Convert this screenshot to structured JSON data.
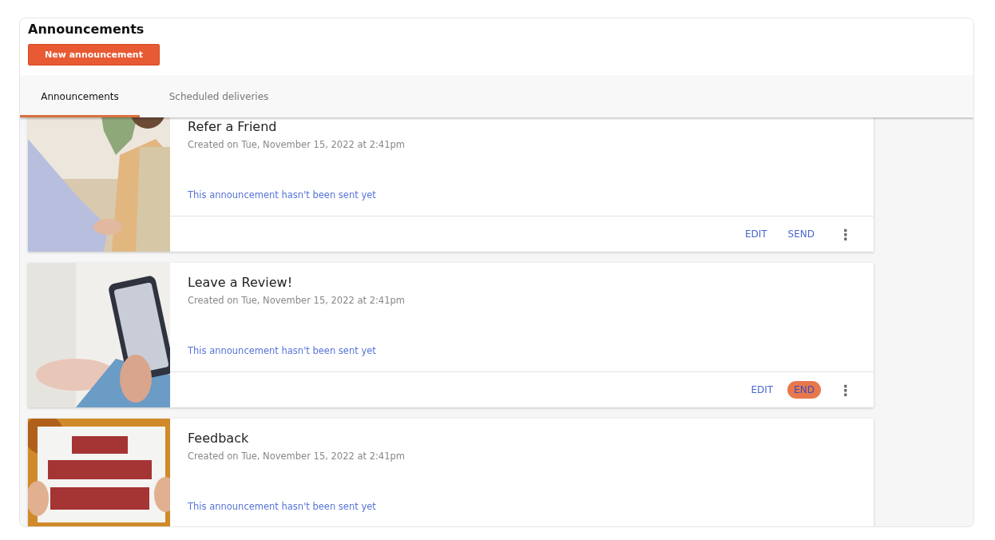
{
  "page": {
    "title": "Announcements",
    "new_button": "New announcement"
  },
  "tabs": [
    {
      "label": "Announcements",
      "selected": true
    },
    {
      "label": "Scheduled deliveries",
      "selected": false
    }
  ],
  "announcements": [
    {
      "title": "Refer a Friend",
      "created": "Created on Tue, November 15, 2022 at 2:41pm",
      "status": "This announcement hasn't been sent yet",
      "picture": {
        "kind": "picture"
      },
      "actions": [
        {
          "label": "EDIT",
          "highlighted": false
        },
        {
          "label": "SEND",
          "highlighted": false
        }
      ],
      "menu": "⋮"
    },
    {
      "title": "Leave a Review!",
      "created": "Created on Tue, November 15, 2022 at 2:41pm",
      "status": "This announcement hasn't been sent yet",
      "picture": {
        "kind": "picture"
      },
      "actions": [
        {
          "label": "EDIT",
          "highlighted": false
        },
        {
          "label": "END",
          "highlighted": true
        }
      ],
      "menu": "⋮"
    },
    {
      "title": "Feedback",
      "created": "Created on Tue, November 15, 2022 at 2:41pm",
      "status": "This announcement hasn't been sent yet",
      "picture": {
        "kind": "picture"
      }
    }
  ]
}
